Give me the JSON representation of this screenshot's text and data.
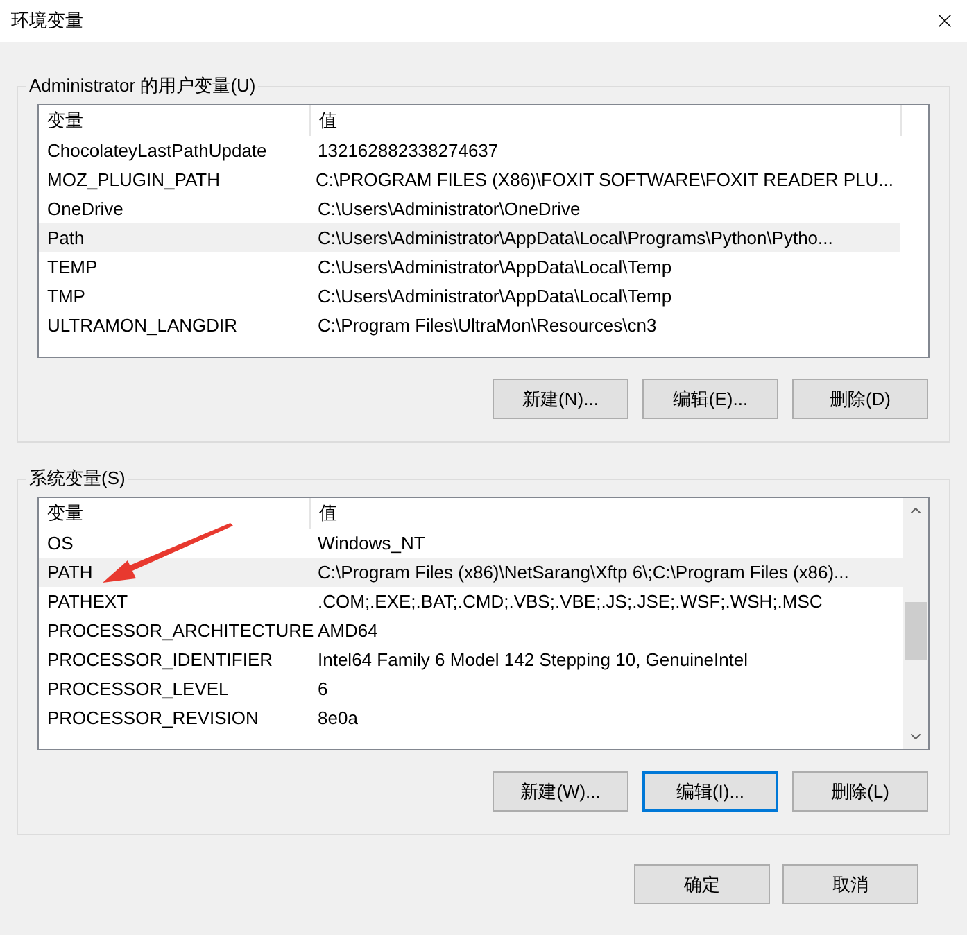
{
  "window": {
    "title": "环境变量"
  },
  "user_variables": {
    "label": "Administrator 的用户变量(U)",
    "columns": [
      "变量",
      "值"
    ],
    "rows": [
      {
        "name": "ChocolateyLastPathUpdate",
        "value": "132162882338274637",
        "selected": false
      },
      {
        "name": "MOZ_PLUGIN_PATH",
        "value": "C:\\PROGRAM FILES (X86)\\FOXIT SOFTWARE\\FOXIT READER PLU...",
        "selected": false
      },
      {
        "name": "OneDrive",
        "value": "C:\\Users\\Administrator\\OneDrive",
        "selected": false
      },
      {
        "name": "Path",
        "value": "C:\\Users\\Administrator\\AppData\\Local\\Programs\\Python\\Pytho...",
        "selected": true
      },
      {
        "name": "TEMP",
        "value": "C:\\Users\\Administrator\\AppData\\Local\\Temp",
        "selected": false
      },
      {
        "name": "TMP",
        "value": "C:\\Users\\Administrator\\AppData\\Local\\Temp",
        "selected": false
      },
      {
        "name": "ULTRAMON_LANGDIR",
        "value": "C:\\Program Files\\UltraMon\\Resources\\cn3",
        "selected": false
      }
    ],
    "buttons": [
      {
        "label": "新建(N)...",
        "focused": false
      },
      {
        "label": "编辑(E)...",
        "focused": false
      },
      {
        "label": "删除(D)",
        "focused": false
      }
    ]
  },
  "system_variables": {
    "label": "系统变量(S)",
    "columns": [
      "变量",
      "值"
    ],
    "rows": [
      {
        "name": "OS",
        "value": "Windows_NT",
        "selected": false
      },
      {
        "name": "PATH",
        "value": "C:\\Program Files (x86)\\NetSarang\\Xftp 6\\;C:\\Program Files (x86)...",
        "selected": true
      },
      {
        "name": "PATHEXT",
        "value": ".COM;.EXE;.BAT;.CMD;.VBS;.VBE;.JS;.JSE;.WSF;.WSH;.MSC",
        "selected": false
      },
      {
        "name": "PROCESSOR_ARCHITECTURE",
        "value": "AMD64",
        "selected": false
      },
      {
        "name": "PROCESSOR_IDENTIFIER",
        "value": "Intel64 Family 6 Model 142 Stepping 10, GenuineIntel",
        "selected": false
      },
      {
        "name": "PROCESSOR_LEVEL",
        "value": "6",
        "selected": false
      },
      {
        "name": "PROCESSOR_REVISION",
        "value": "8e0a",
        "selected": false
      }
    ],
    "buttons": [
      {
        "label": "新建(W)...",
        "focused": false
      },
      {
        "label": "编辑(I)...",
        "focused": true
      },
      {
        "label": "删除(L)",
        "focused": false
      }
    ]
  },
  "buttons": [
    {
      "label": "确定",
      "focused": false
    },
    {
      "label": "取消",
      "focused": false
    }
  ]
}
